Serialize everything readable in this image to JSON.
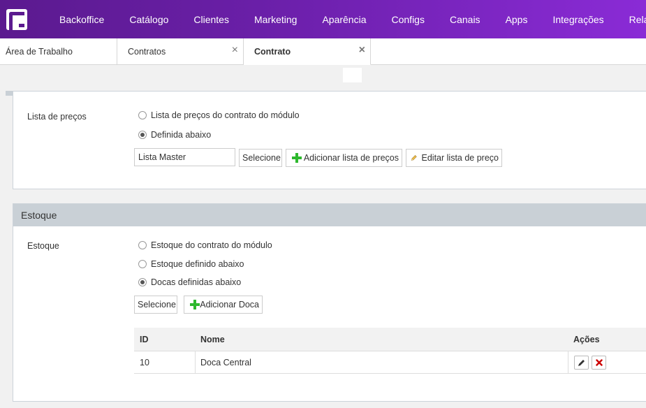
{
  "nav": {
    "items": [
      "Backoffice",
      "Catálogo",
      "Clientes",
      "Marketing",
      "Aparência",
      "Configs",
      "Canais",
      "Apps",
      "Integrações",
      "Relatórios"
    ]
  },
  "tabs": [
    {
      "label": "Área de Trabalho"
    },
    {
      "label": "Contratos",
      "close": "×"
    },
    {
      "label": "Contrato",
      "close": "×"
    }
  ],
  "price_list": {
    "label": "Lista de preços",
    "options": [
      "Lista de preços do contrato do módulo",
      "Definida abaixo"
    ],
    "selected_index": 1,
    "input_value": "Lista Master",
    "select_label": "Selecione",
    "add_label": "Adicionar lista de preços",
    "edit_label": "Editar lista de preço"
  },
  "stock": {
    "header": "Estoque",
    "label": "Estoque",
    "options": [
      "Estoque do contrato do módulo",
      "Estoque definido abaixo",
      "Docas definidas abaixo"
    ],
    "selected_index": 2,
    "select_label": "Selecione",
    "add_label": "Adicionar Doca",
    "table": {
      "columns": [
        "ID",
        "Nome",
        "Ações"
      ],
      "rows": [
        {
          "id": "10",
          "name": "Doca Central"
        }
      ]
    }
  }
}
